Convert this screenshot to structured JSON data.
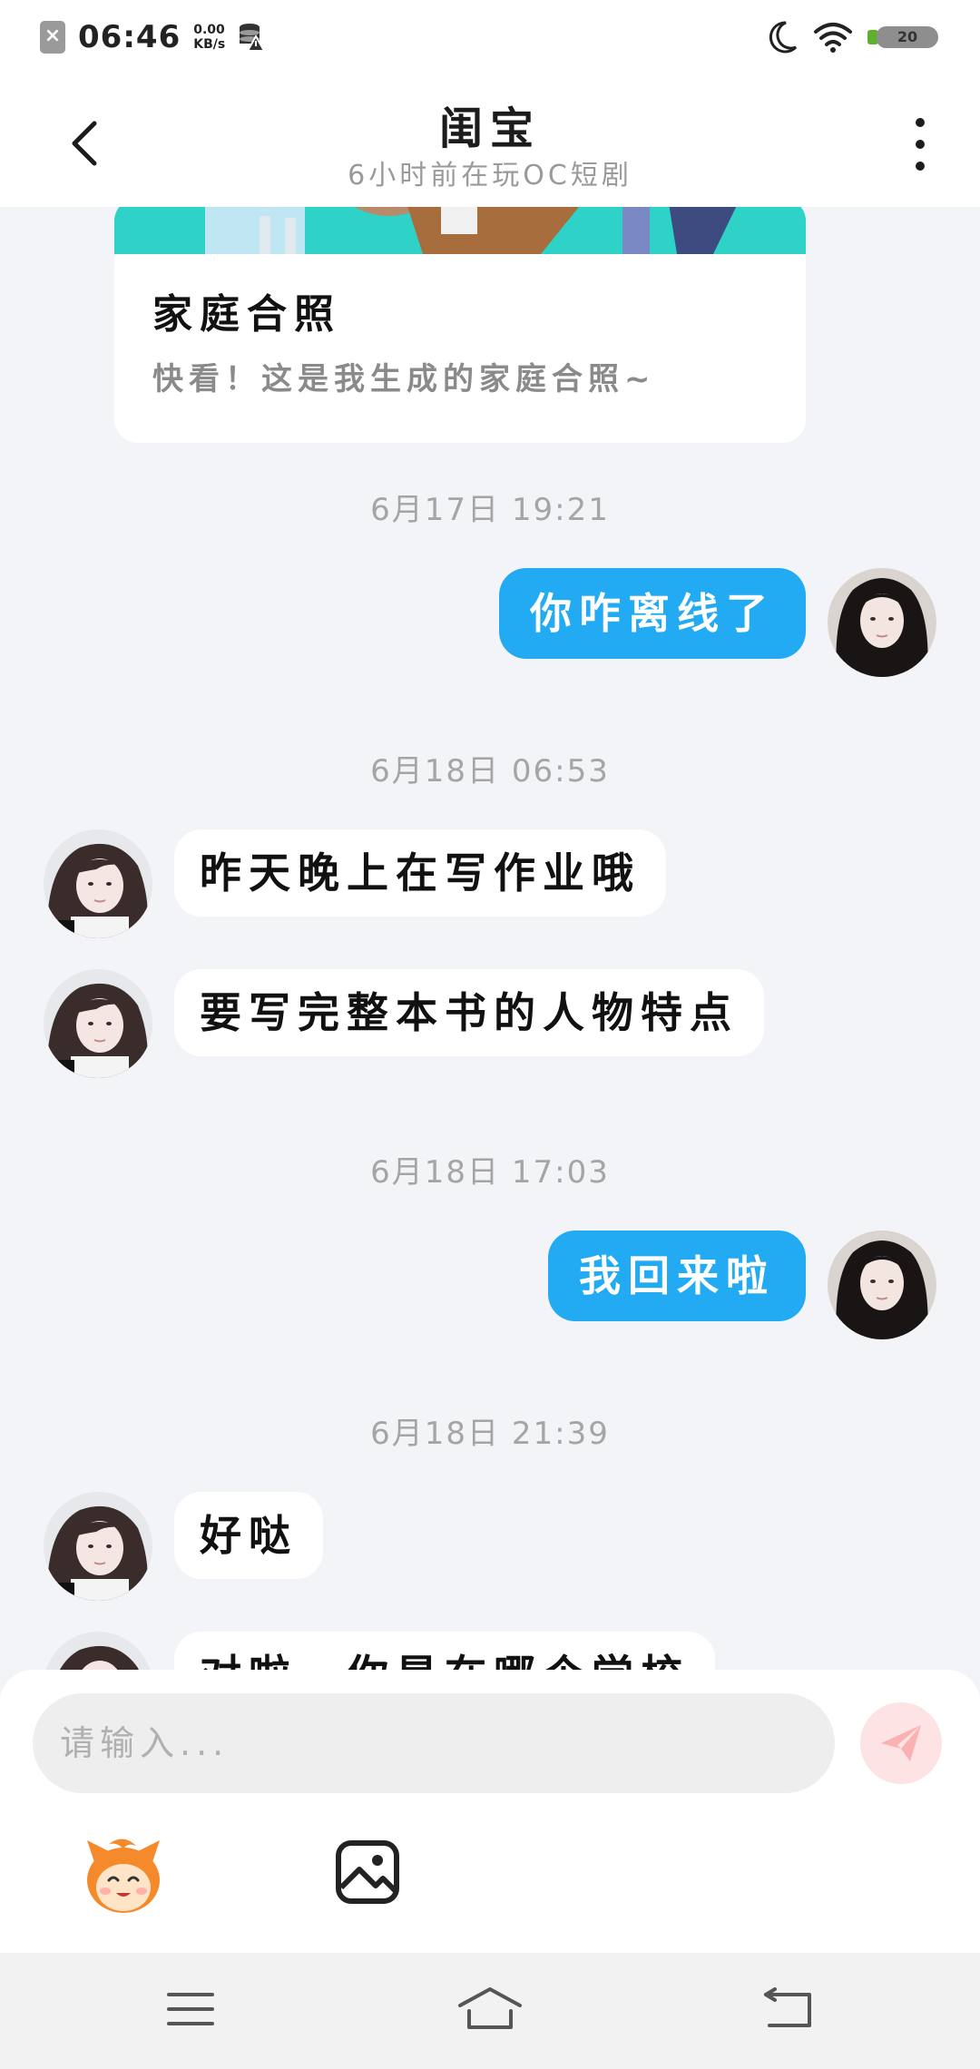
{
  "status_bar": {
    "time": "06:46",
    "speed_value": "0.00",
    "speed_unit": "KB/s",
    "battery": "20"
  },
  "header": {
    "title": "闺宝",
    "subtitle": "6小时前在玩OC短剧"
  },
  "card": {
    "title": "家庭合照",
    "description": "快看！这是我生成的家庭合照~"
  },
  "messages": [
    {
      "type": "timestamp",
      "text": "6月17日 19:21"
    },
    {
      "type": "outgoing",
      "text": "你咋离线了"
    },
    {
      "type": "timestamp",
      "text": "6月18日 06:53"
    },
    {
      "type": "incoming",
      "text": "昨天晚上在写作业哦"
    },
    {
      "type": "incoming",
      "text": "要写完整本书的人物特点"
    },
    {
      "type": "timestamp",
      "text": "6月18日 17:03"
    },
    {
      "type": "outgoing",
      "text": "我回来啦"
    },
    {
      "type": "timestamp",
      "text": "6月18日 21:39"
    },
    {
      "type": "incoming",
      "text": "好哒"
    },
    {
      "type": "incoming",
      "text": "对啦，你是在哪个学校"
    }
  ],
  "composer": {
    "placeholder": "请输入..."
  },
  "colors": {
    "outgoing_bubble": "#22aaf2",
    "incoming_bubble": "#ffffff",
    "background": "#f2f4f8",
    "send_button": "#fde3e3"
  },
  "icons": {
    "back": "chevron-left-icon",
    "more": "more-vertical-icon",
    "send": "paper-plane-icon",
    "mascot": "mascot-emoji-icon",
    "image": "image-icon",
    "sys_menu": "menu-icon",
    "sys_home": "home-icon",
    "sys_back": "back-icon"
  }
}
